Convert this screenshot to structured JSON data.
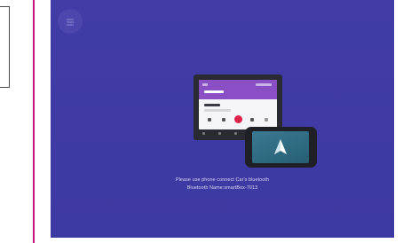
{
  "screen": {
    "background_color": "#3f3aa3",
    "menu_icon": "menu-icon",
    "illustration": {
      "head_unit_accent": "#8a4fc4",
      "play_button_color": "#e0234a",
      "phone_screen_color": "#2f6f87",
      "logo": "android-auto-navigation-icon"
    },
    "message": {
      "line1": "Please use phone connect Car's bluetooth",
      "line2": "Bluetooth Name:smartBox-7013"
    }
  },
  "layout_accent": {
    "divider_color": "#c2187a"
  }
}
